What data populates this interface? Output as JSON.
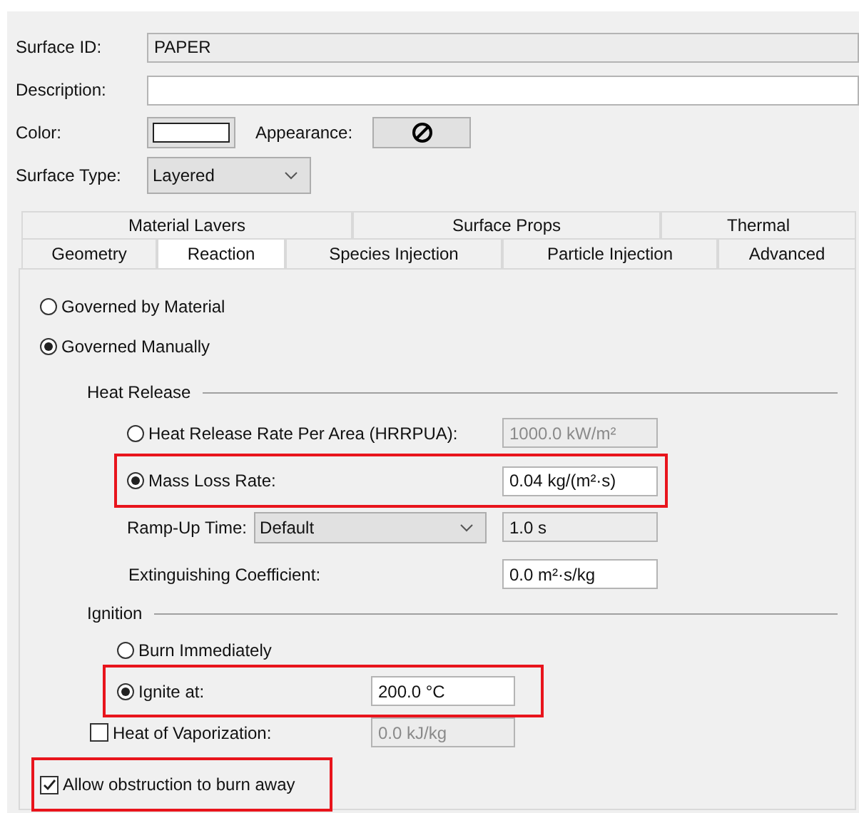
{
  "surface_id": {
    "label": "Surface ID:",
    "value": "PAPER",
    "editable": false
  },
  "description": {
    "label": "Description:",
    "editable": true
  },
  "color": {
    "label": "Color:"
  },
  "appearance": {
    "label": "Appearance:"
  },
  "surface_type": {
    "label": "Surface Type:",
    "value": "Layered"
  },
  "tabs": [
    [
      {
        "label": "Material Lavers",
        "selected": false
      },
      {
        "label": "Surface Props",
        "selected": false
      },
      {
        "label": "Thermal",
        "selected": false
      }
    ],
    [
      {
        "label": "Geometry",
        "selected": false
      },
      {
        "label": "Reaction",
        "selected": true
      },
      {
        "label": "Species Injection",
        "selected": false
      },
      {
        "label": "Particle Injection",
        "selected": false
      },
      {
        "label": "Advanced",
        "selected": false
      }
    ]
  ],
  "governing": [
    {
      "label": "Governed by Material",
      "selected": false
    },
    {
      "label": "Governed Manually",
      "selected": true
    }
  ],
  "heat_release": {
    "title": "Heat Release",
    "rows": [
      {
        "kind": "radio",
        "label": "Heat Release Rate Per Area (HRRPUA):",
        "selected": false,
        "value": "1000.0 kW/m²",
        "disabled": true,
        "highlighted": false
      },
      {
        "kind": "radio",
        "label": "Mass Loss Rate:",
        "selected": true,
        "value": "0.04 kg/(m²·s)",
        "editable": true,
        "highlighted": true
      },
      {
        "kind": "select",
        "label": "Ramp-Up Time:",
        "select": "Default",
        "value": "1.0 s",
        "editable": false,
        "highlighted": false
      },
      {
        "kind": "plain",
        "label": "Extinguishing Coefficient:",
        "value": "0.0 m²·s/kg",
        "editable": true,
        "highlighted": false
      }
    ]
  },
  "ignition": {
    "title": "Ignition",
    "rows": [
      {
        "kind": "radio",
        "label": "Burn Immediately",
        "selected": false,
        "highlighted": false
      },
      {
        "kind": "radio",
        "label": "Ignite at:",
        "selected": true,
        "value": "200.0 °C",
        "editable": true,
        "highlighted": true
      }
    ]
  },
  "heat_of_vaporization": {
    "label": "Heat of Vaporization:",
    "checked": false,
    "value": "0.0 kJ/kg",
    "disabled": true
  },
  "burn_away": {
    "label": "Allow obstruction to burn away",
    "checked": true,
    "highlighted": true
  }
}
